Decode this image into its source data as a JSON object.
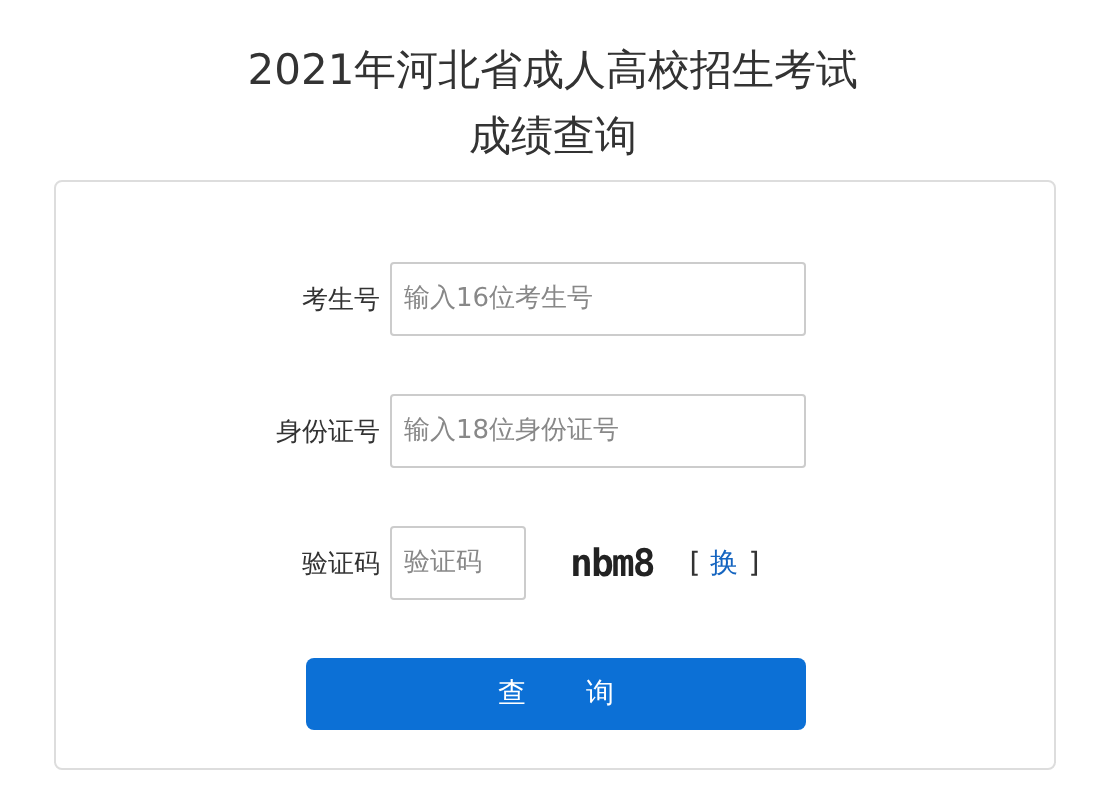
{
  "title_lines": [
    "2021年河北省成人高校招生考试",
    "成绩查询"
  ],
  "fields": [
    {
      "kind": "text",
      "label": "考生号",
      "placeholder": "输入16位考生号"
    },
    {
      "kind": "text",
      "label": "身份证号",
      "placeholder": "输入18位身份证号"
    },
    {
      "kind": "captcha",
      "label": "验证码",
      "placeholder": "验证码",
      "captcha": "nbm8",
      "bracket_open": "[",
      "refresh": "换",
      "bracket_close": "]"
    }
  ],
  "submit": "查 询"
}
